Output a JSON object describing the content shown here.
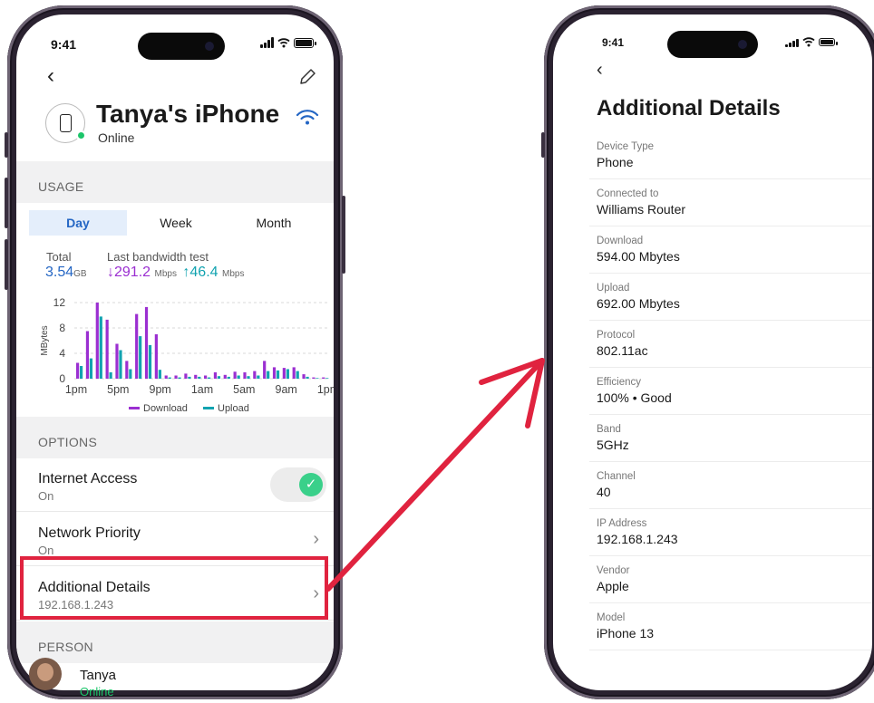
{
  "colors": {
    "accent": "#2466c4",
    "download": "#9b2fd1",
    "upload": "#12a3b0",
    "online": "#1cc56a",
    "highlight": "#e0233f"
  },
  "status_bar": {
    "time": "9:41"
  },
  "device": {
    "name": "Tanya's iPhone",
    "status": "Online"
  },
  "icons": {
    "back": "chevron-left-icon",
    "edit": "pencil-icon",
    "wifi": "wifi-icon"
  },
  "usage": {
    "header": "USAGE",
    "tabs": [
      "Day",
      "Week",
      "Month"
    ],
    "active_tab": "Day",
    "total_label": "Total",
    "total_value": "3.54",
    "total_unit": "GB",
    "bandwidth_label": "Last bandwidth test",
    "download_arrow": "↓",
    "download_value": "291.2",
    "upload_arrow": "↑",
    "upload_value": "46.4",
    "speed_unit": "Mbps"
  },
  "chart_data": {
    "type": "bar",
    "ylabel": "MBytes",
    "ylim": [
      0,
      12
    ],
    "yticks": [
      "0",
      "4",
      "8",
      "12"
    ],
    "xticks": [
      "1pm",
      "5pm",
      "9pm",
      "1am",
      "5am",
      "9am",
      "1pm"
    ],
    "series": [
      {
        "name": "Download",
        "values": [
          2.5,
          7.5,
          12,
          9.3,
          5.5,
          2.8,
          10.2,
          11.3,
          7,
          0.5,
          0.5,
          0.8,
          0.6,
          0.5,
          1,
          0.6,
          1.1,
          1,
          1.2,
          2.8,
          1.8,
          1.7,
          1.8,
          0.7,
          0.2,
          0.2
        ]
      },
      {
        "name": "Upload",
        "values": [
          2,
          3.2,
          9.8,
          1,
          4.5,
          1.5,
          6.7,
          5.3,
          1.4,
          0.2,
          0.2,
          0.3,
          0.3,
          0.2,
          0.4,
          0.3,
          0.5,
          0.4,
          0.5,
          1.2,
          1.3,
          1.5,
          1.2,
          0.3,
          0.1,
          0.1
        ]
      }
    ],
    "legend": [
      "Download",
      "Upload"
    ],
    "legend_position": "bottom"
  },
  "options": {
    "header": "OPTIONS",
    "internet_access": {
      "title": "Internet Access",
      "sub": "On",
      "enabled": true
    },
    "network_priority": {
      "title": "Network Priority",
      "sub": "On"
    },
    "additional_details": {
      "title": "Additional Details",
      "sub": "192.168.1.243"
    }
  },
  "person": {
    "header": "PERSON",
    "name": "Tanya",
    "status": "Online"
  },
  "details": {
    "title": "Additional Details",
    "rows": [
      {
        "label": "Device Type",
        "value": "Phone"
      },
      {
        "label": "Connected to",
        "value": "Williams Router"
      },
      {
        "label": "Download",
        "value": "594.00 Mbytes"
      },
      {
        "label": "Upload",
        "value": "692.00 Mbytes"
      },
      {
        "label": "Protocol",
        "value": "802.11ac"
      },
      {
        "label": "Efficiency",
        "value": "100% • Good"
      },
      {
        "label": "Band",
        "value": "5GHz"
      },
      {
        "label": "Channel",
        "value": "40"
      },
      {
        "label": "IP Address",
        "value": "192.168.1.243"
      },
      {
        "label": "Vendor",
        "value": "Apple"
      },
      {
        "label": "Model",
        "value": "iPhone 13"
      }
    ]
  }
}
